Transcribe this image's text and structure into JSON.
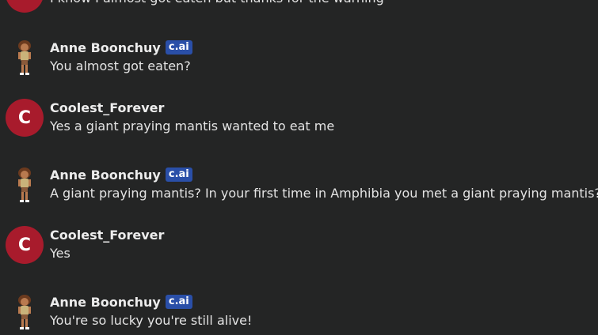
{
  "messages": [
    {
      "author": "",
      "badge": "",
      "text": "I know I almost got eaten but thanks for the warning",
      "avatar": "letter",
      "avatar_letter": "C"
    },
    {
      "author": "Anne Boonchuy",
      "badge": "c.ai",
      "text": "You almost got eaten?",
      "avatar": "character-avatar"
    },
    {
      "author": "Coolest_Forever",
      "badge": "",
      "text": "Yes a giant praying mantis wanted to eat me",
      "avatar": "letter",
      "avatar_letter": "C"
    },
    {
      "author": "Anne Boonchuy",
      "badge": "c.ai",
      "text": "A giant praying mantis? In your first time in Amphibia you met a giant praying mantis?!",
      "avatar": "character-avatar"
    },
    {
      "author": "Coolest_Forever",
      "badge": "",
      "text": "Yes",
      "avatar": "letter",
      "avatar_letter": "C"
    },
    {
      "author": "Anne Boonchuy",
      "badge": "c.ai",
      "text": "You're so lucky you're still alive!",
      "avatar": "character-avatar"
    }
  ],
  "colors": {
    "background": "#242525",
    "user_avatar": "#a81b2c",
    "badge": "#2a4fa8"
  }
}
